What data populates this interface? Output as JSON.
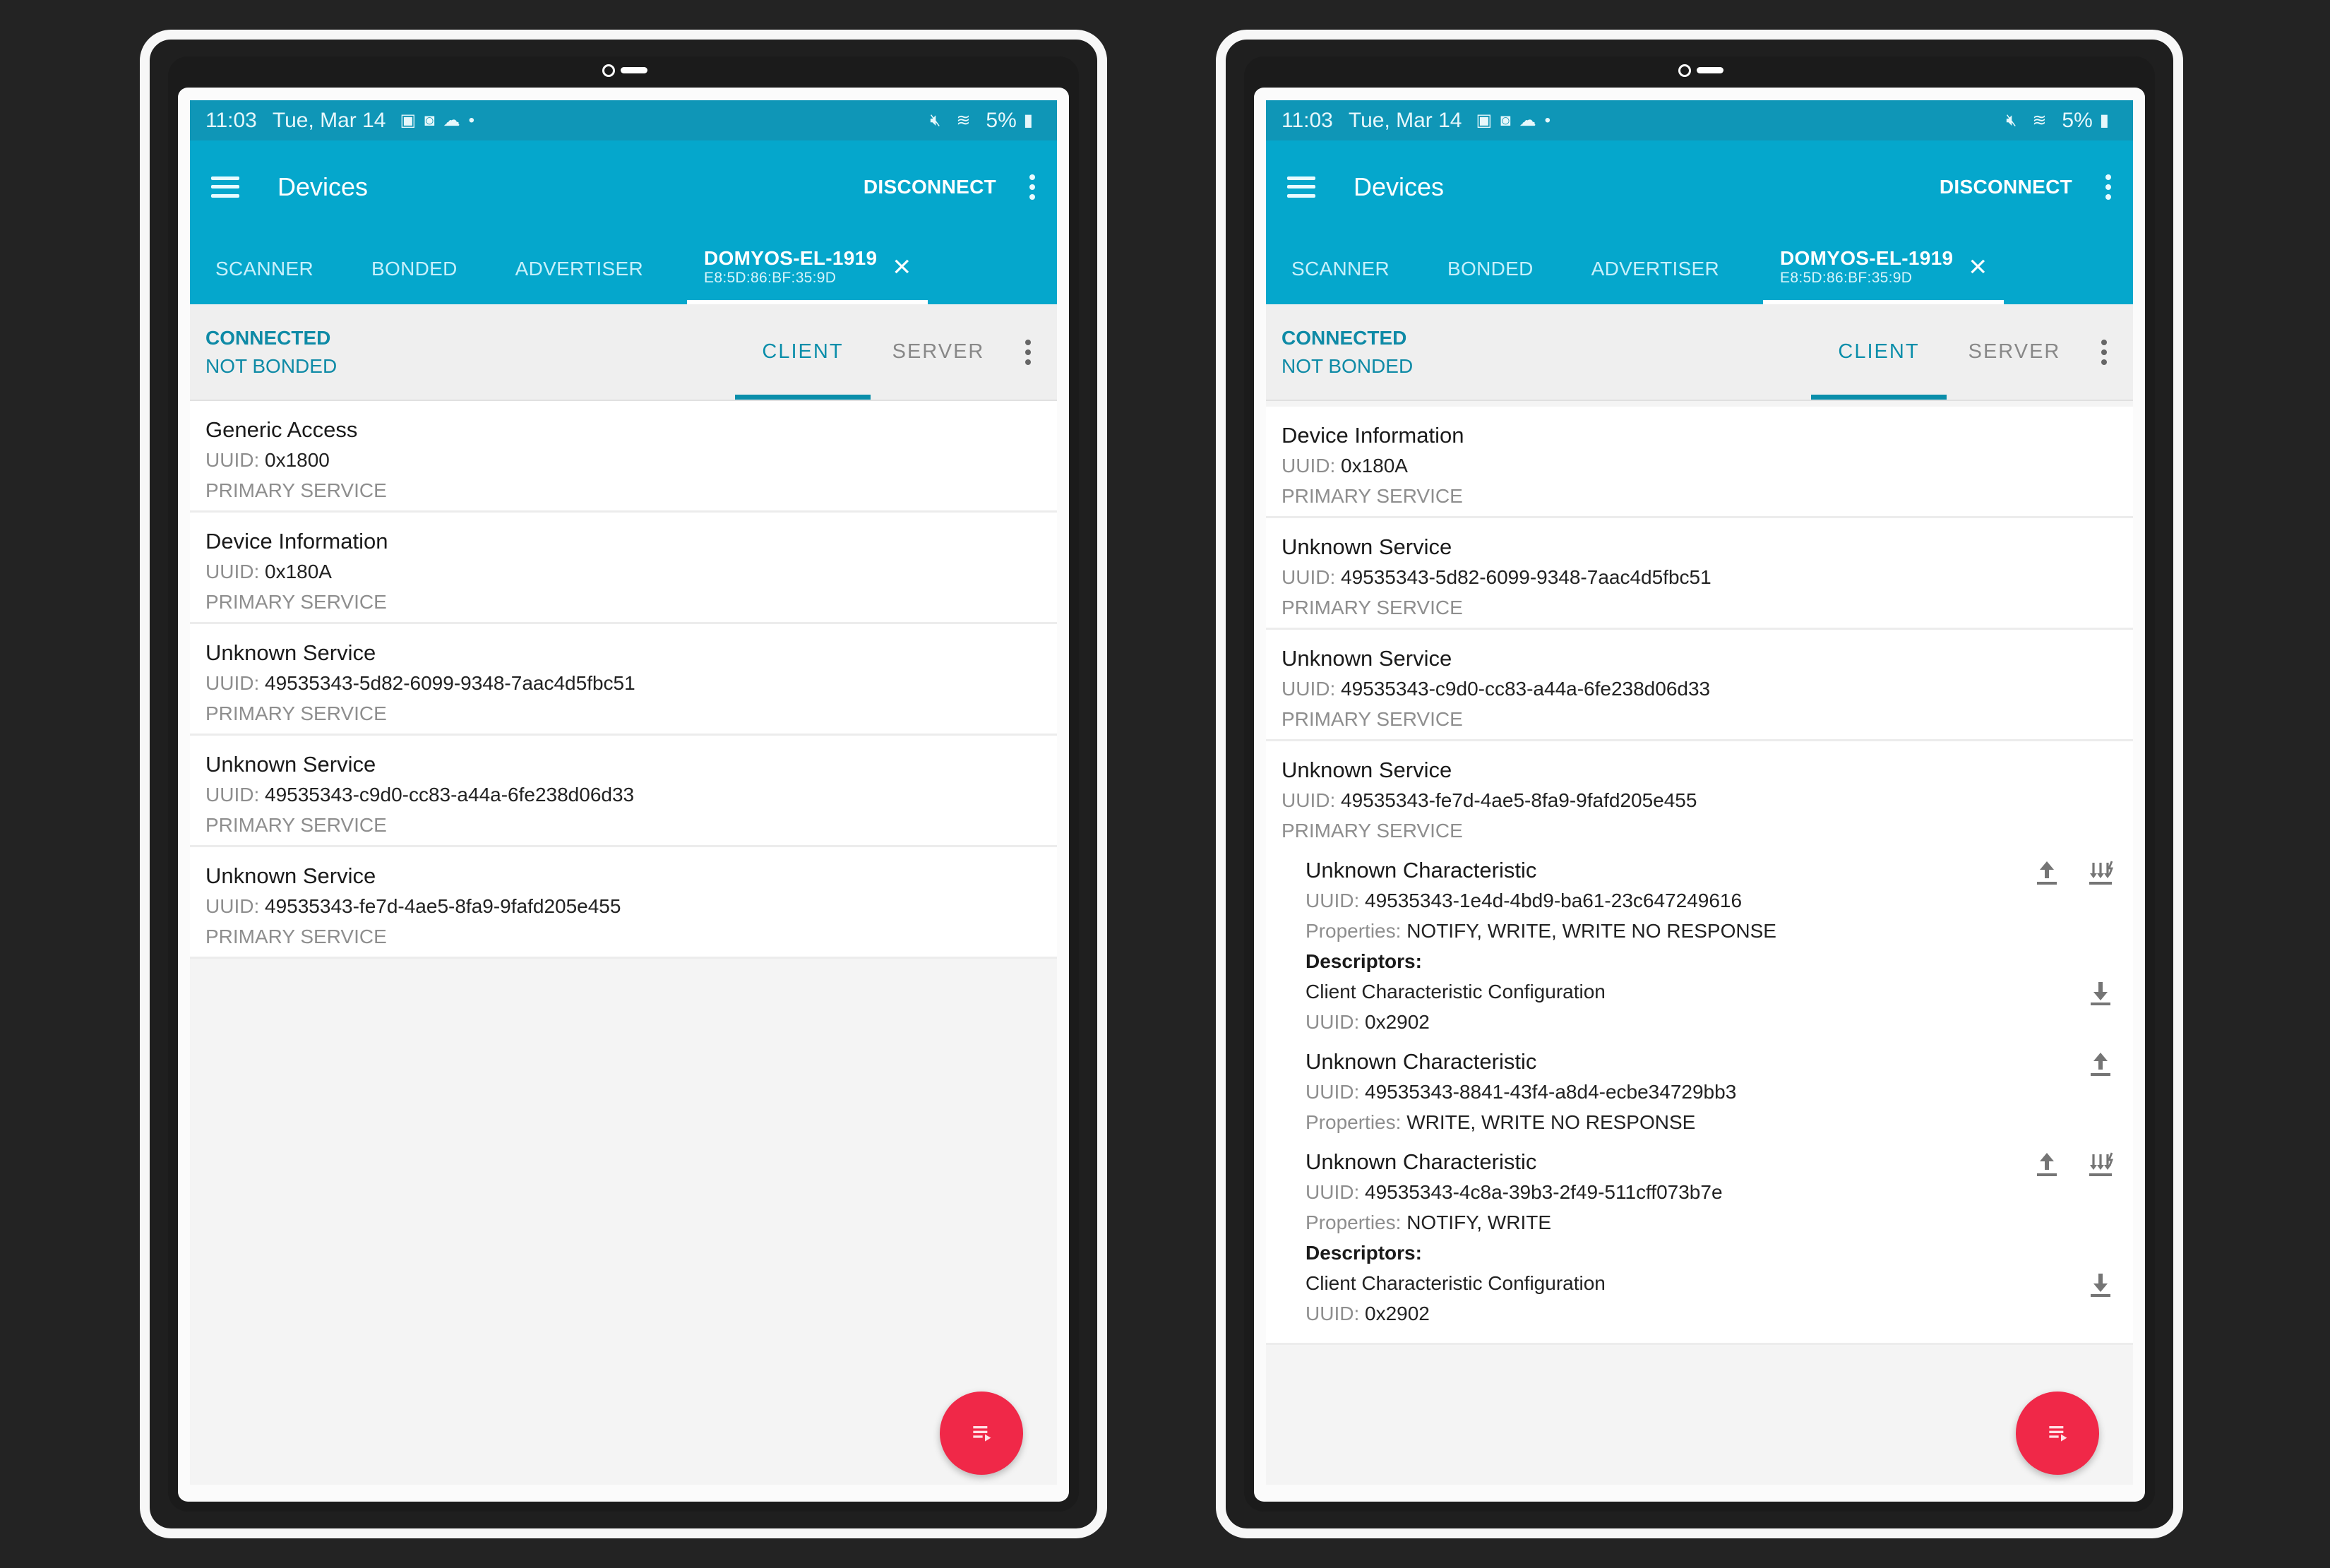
{
  "status_bar": {
    "time": "11:03",
    "date": "Tue, Mar 14",
    "left_icons": [
      "gallery-icon",
      "camera-app-icon",
      "cloud-icon",
      "dot-icon"
    ],
    "right_icons": [
      "mute-icon",
      "wifi-icon"
    ],
    "battery_text": "5%"
  },
  "app_bar": {
    "title": "Devices",
    "disconnect_label": "DISCONNECT"
  },
  "tabs": {
    "items": [
      "SCANNER",
      "BONDED",
      "ADVERTISER"
    ],
    "active_device": {
      "name": "DOMYOS-EL-1919",
      "address": "E8:5D:86:BF:35:9D",
      "close": "×"
    }
  },
  "connection": {
    "state": "CONNECTED",
    "bond": "NOT BONDED",
    "subtabs": [
      "CLIENT",
      "SERVER"
    ],
    "active_subtab": "CLIENT"
  },
  "labels": {
    "uuid": "UUID:",
    "properties": "Properties:",
    "descriptors": "Descriptors:"
  },
  "left_screen": {
    "services": [
      {
        "name": "Generic Access",
        "uuid": "0x1800",
        "type": "PRIMARY SERVICE"
      },
      {
        "name": "Device Information",
        "uuid": "0x180A",
        "type": "PRIMARY SERVICE"
      },
      {
        "name": "Unknown Service",
        "uuid": "49535343-5d82-6099-9348-7aac4d5fbc51",
        "type": "PRIMARY SERVICE"
      },
      {
        "name": "Unknown Service",
        "uuid": "49535343-c9d0-cc83-a44a-6fe238d06d33",
        "type": "PRIMARY SERVICE"
      },
      {
        "name": "Unknown Service",
        "uuid": "49535343-fe7d-4ae5-8fa9-9fafd205e455",
        "type": "PRIMARY SERVICE"
      }
    ]
  },
  "right_screen": {
    "services": [
      {
        "name": "Device Information",
        "uuid": "0x180A",
        "type": "PRIMARY SERVICE"
      },
      {
        "name": "Unknown Service",
        "uuid": "49535343-5d82-6099-9348-7aac4d5fbc51",
        "type": "PRIMARY SERVICE"
      },
      {
        "name": "Unknown Service",
        "uuid": "49535343-c9d0-cc83-a44a-6fe238d06d33",
        "type": "PRIMARY SERVICE"
      },
      {
        "name": "Unknown Service",
        "uuid": "49535343-fe7d-4ae5-8fa9-9fafd205e455",
        "type": "PRIMARY SERVICE"
      }
    ],
    "characteristics": [
      {
        "name": "Unknown Characteristic",
        "uuid": "49535343-1e4d-4bd9-ba61-23c647249616",
        "properties": "NOTIFY, WRITE, WRITE NO RESPONSE",
        "actions": [
          "write-icon",
          "notify-icon"
        ],
        "descriptor": {
          "name": "Client Characteristic Configuration",
          "uuid": "0x2902",
          "action": "read-icon"
        }
      },
      {
        "name": "Unknown Characteristic",
        "uuid": "49535343-8841-43f4-a8d4-ecbe34729bb3",
        "properties": "WRITE, WRITE NO RESPONSE",
        "actions": [
          "write-icon"
        ]
      },
      {
        "name": "Unknown Characteristic",
        "uuid": "49535343-4c8a-39b3-2f49-511cff073b7e",
        "properties": "NOTIFY, WRITE",
        "actions": [
          "write-icon",
          "notify-icon"
        ],
        "descriptor": {
          "name": "Client Characteristic Configuration",
          "uuid": "0x2902",
          "action": "read-icon"
        }
      }
    ]
  },
  "colors": {
    "status_bar": "#0f96b7",
    "app_bar": "#05a7cc",
    "accent": "#0a8eaa",
    "fab": "#f02848",
    "background": "#232323"
  },
  "fab": {
    "icon": "log-icon"
  }
}
